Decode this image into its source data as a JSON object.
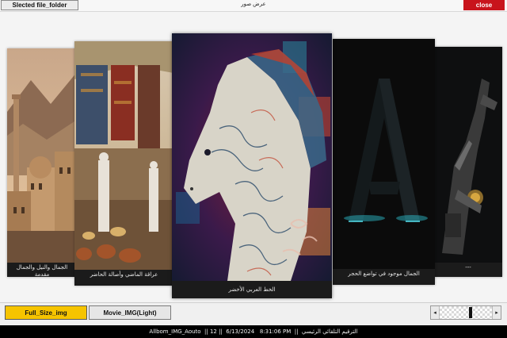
{
  "titlebar": {
    "select_folder_label": "Slected file_folder",
    "window_title": "عرض صور",
    "close_label": "close",
    "close_color": "#c8141c"
  },
  "gallery": {
    "cards": [
      {
        "caption": "الجمال والنيل والجمال مقدمة",
        "theme": "desert-city"
      },
      {
        "caption": "عراقة الماضي وأصالة الحاضر",
        "theme": "market-street"
      },
      {
        "caption": "الخط العربي الأخضر",
        "theme": "calligraphy-horse"
      },
      {
        "caption": "الجمال موجود في تواضع الحجر",
        "theme": "dark-letter-a"
      },
      {
        "caption": "---",
        "theme": "robot-arm"
      }
    ]
  },
  "bottombar": {
    "full_size_label": "Full_Size_img",
    "full_size_color": "#f6c400",
    "movie_label": "Movie_IMG(Light)",
    "scroll_left_icon": "◂",
    "scroll_right_icon": "▸",
    "scroll_position": 0.6
  },
  "statusbar": {
    "text": "Allbom_IMG_Aouto  || 12 ||  6/13/2024   8:31:06 PM  ||  الترقيم التلقائي الرئيسي"
  }
}
